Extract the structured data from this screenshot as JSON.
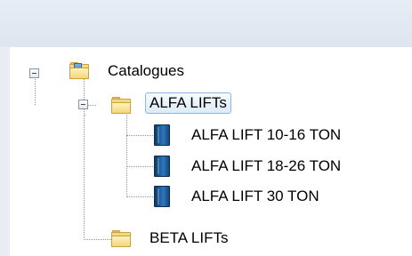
{
  "tree": {
    "root": {
      "label": "Catalogues",
      "icon": "catalog-folder-icon",
      "expanded": true,
      "children": [
        {
          "label": "ALFA LIFTs",
          "icon": "folder-icon",
          "expanded": true,
          "selected": true,
          "children": [
            {
              "label": "ALFA LIFT 10-16 TON",
              "icon": "book-icon"
            },
            {
              "label": "ALFA LIFT 18-26 TON",
              "icon": "book-icon"
            },
            {
              "label": "ALFA LIFT 30 TON",
              "icon": "book-icon"
            }
          ]
        },
        {
          "label": "BETA LIFTs",
          "icon": "folder-icon",
          "expanded": false
        }
      ]
    }
  },
  "colors": {
    "selection_border": "#8fb6e0",
    "selection_fill": "#dcebfa",
    "connector": "#8e98a3",
    "book": "#1f5f9c",
    "folder": "#f4d67a"
  }
}
